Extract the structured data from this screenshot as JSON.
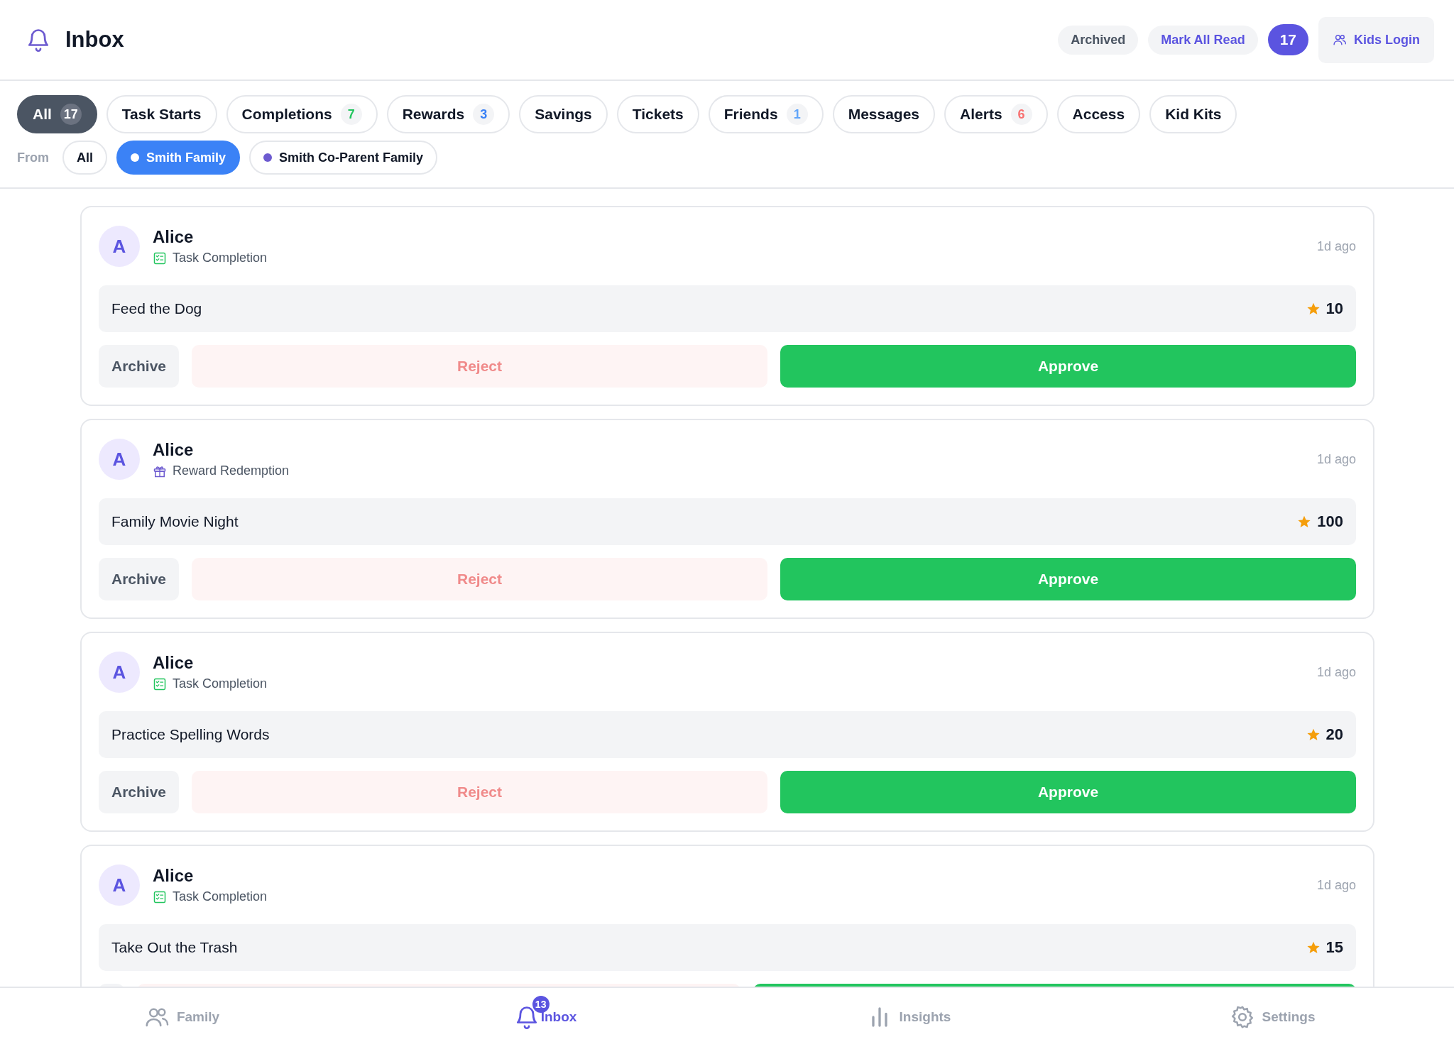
{
  "header": {
    "title": "Inbox",
    "archived_button": "Archived",
    "mark_all_read_button": "Mark All Read",
    "unread_count": "17",
    "kids_login_button": "Kids Login"
  },
  "tabs": [
    {
      "label": "All",
      "count": "17",
      "selected": true
    },
    {
      "label": "Task Starts",
      "selected": false
    },
    {
      "label": "Completions",
      "count": "7",
      "selected": false,
      "color": "#22c55e"
    },
    {
      "label": "Rewards",
      "count": "3",
      "selected": false,
      "color": "#3b82f6"
    },
    {
      "label": "Savings",
      "selected": false
    },
    {
      "label": "Tickets",
      "selected": false
    },
    {
      "label": "Friends",
      "count": "1",
      "selected": false,
      "color": "#60a5fa"
    },
    {
      "label": "Messages",
      "selected": false
    },
    {
      "label": "Alerts",
      "count": "6",
      "selected": false,
      "color": "#f87171"
    },
    {
      "label": "Access",
      "selected": false
    },
    {
      "label": "Kid Kits",
      "selected": false
    }
  ],
  "from_label": "From",
  "families": [
    {
      "label": "All",
      "selected": false
    },
    {
      "label": "Smith Family",
      "selected": true,
      "color": "#ffffff"
    },
    {
      "label": "Smith Co-Parent Family",
      "selected": false,
      "color": "#6d5bd0"
    }
  ],
  "cards": [
    {
      "initial": "A",
      "name": "Alice",
      "kind": "task_completion",
      "type_label": "Task Completion",
      "time": "1d ago",
      "item": "Feed the Dog",
      "points": "10",
      "actions": [
        {
          "label": "Archive",
          "kind": "archive"
        },
        {
          "label": "Reject",
          "kind": "reject"
        },
        {
          "label": "Approve",
          "kind": "approve"
        }
      ]
    },
    {
      "initial": "A",
      "name": "Alice",
      "kind": "reward_redemption",
      "type_label": "Reward Redemption",
      "time": "1d ago",
      "item": "Family Movie Night",
      "points": "100",
      "actions": [
        {
          "label": "Archive",
          "kind": "archive"
        },
        {
          "label": "Reject",
          "kind": "reject"
        },
        {
          "label": "Approve",
          "kind": "approve"
        }
      ]
    },
    {
      "initial": "A",
      "name": "Alice",
      "kind": "task_completion",
      "type_label": "Task Completion",
      "time": "1d ago",
      "item": "Practice Spelling Words",
      "points": "20",
      "actions": [
        {
          "label": "Archive",
          "kind": "archive"
        },
        {
          "label": "Reject",
          "kind": "reject"
        },
        {
          "label": "Approve",
          "kind": "approve"
        }
      ]
    },
    {
      "initial": "A",
      "name": "Alice",
      "kind": "task_completion",
      "type_label": "Task Completion",
      "time": "1d ago",
      "item": "Take Out the Trash",
      "points": "15",
      "actions": [
        {
          "kind": "archive"
        },
        {
          "kind": "reject"
        },
        {
          "kind": "approve"
        }
      ]
    }
  ],
  "nav": [
    {
      "label": "Family",
      "kind": "family",
      "selected": false
    },
    {
      "label": "Inbox",
      "kind": "inbox",
      "selected": true,
      "badge": "13"
    },
    {
      "label": "Insights",
      "kind": "insights",
      "selected": false
    },
    {
      "label": "Settings",
      "kind": "settings",
      "selected": false
    }
  ]
}
